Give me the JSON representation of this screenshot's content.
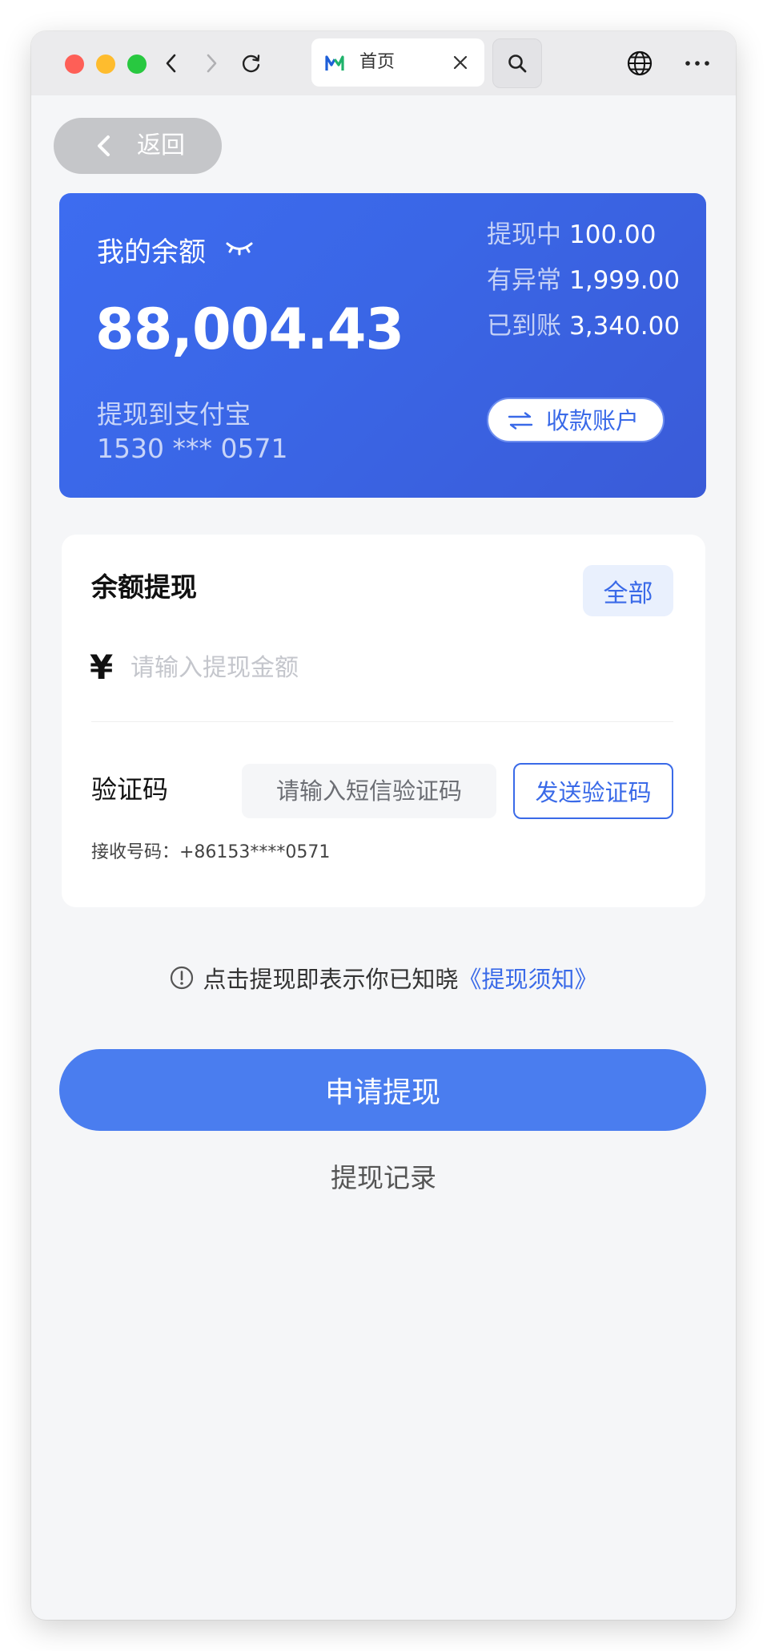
{
  "browser": {
    "tab_title": "首页"
  },
  "page": {
    "back_label": "返回"
  },
  "balance": {
    "title": "我的余额",
    "amount": "88,004.43",
    "withdraw_to": "提现到支付宝",
    "account": "1530 *** 0571",
    "stats": [
      {
        "label": "提现中",
        "value": "100.00"
      },
      {
        "label": "有异常",
        "value": "1,999.00"
      },
      {
        "label": "已到账",
        "value": "3,340.00"
      }
    ],
    "account_button": "收款账户"
  },
  "form": {
    "title": "余额提现",
    "all_button": "全部",
    "currency_symbol": "¥",
    "amount_placeholder": "请输入提现金额",
    "code_label": "验证码",
    "code_placeholder": "请输入短信验证码",
    "send_code_button": "发送验证码",
    "receive_number": "接收号码：+86153****0571"
  },
  "notice": {
    "text": "点击提现即表示你已知晓",
    "link": "《提现须知》"
  },
  "actions": {
    "submit": "申请提现",
    "records": "提现记录"
  },
  "colors": {
    "primary": "#4a7def",
    "card_blue": "#3a66e6",
    "link_blue": "#3a6ae8"
  }
}
